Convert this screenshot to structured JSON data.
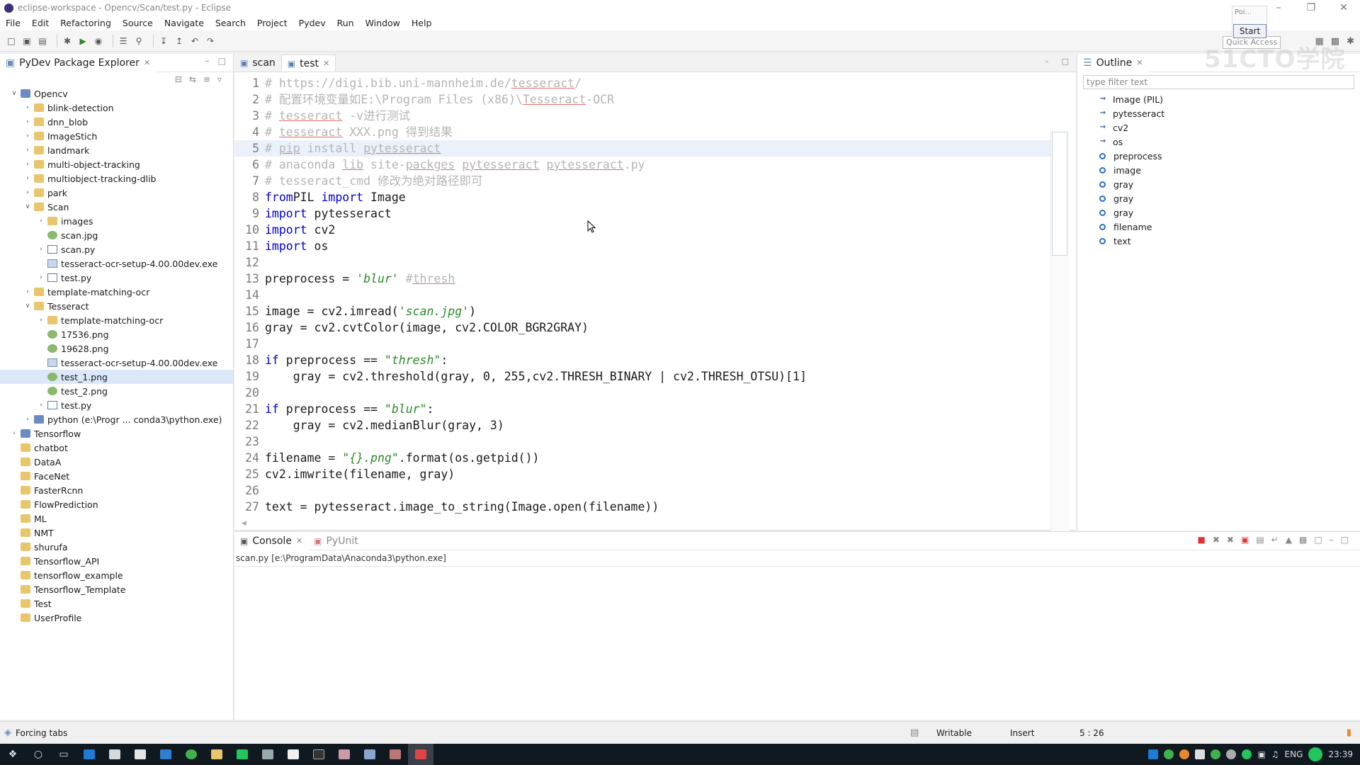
{
  "window": {
    "title": "eclipse-workspace - Opencv/Scan/test.py - Eclipse"
  },
  "menu": [
    "File",
    "Edit",
    "Refactoring",
    "Source",
    "Navigate",
    "Search",
    "Project",
    "Pydev",
    "Run",
    "Window",
    "Help"
  ],
  "toolbar": {
    "quick_access": "Quick Access",
    "popup_text": "Poi...",
    "start_label": "Start"
  },
  "explorer": {
    "title": "PyDev Package Explorer",
    "tree": [
      {
        "label": "Opencv",
        "depth": 0,
        "icon": "project",
        "open": true
      },
      {
        "label": "blink-detection",
        "depth": 1,
        "icon": "folder"
      },
      {
        "label": "dnn_blob",
        "depth": 1,
        "icon": "folder"
      },
      {
        "label": "ImageStich",
        "depth": 1,
        "icon": "folder"
      },
      {
        "label": "landmark",
        "depth": 1,
        "icon": "folder"
      },
      {
        "label": "multi-object-tracking",
        "depth": 1,
        "icon": "folder"
      },
      {
        "label": "multiobject-tracking-dlib",
        "depth": 1,
        "icon": "folder"
      },
      {
        "label": "park",
        "depth": 1,
        "icon": "folder"
      },
      {
        "label": "Scan",
        "depth": 1,
        "icon": "folder",
        "open": true
      },
      {
        "label": "images",
        "depth": 2,
        "icon": "folder"
      },
      {
        "label": "scan.jpg",
        "depth": 2,
        "icon": "image",
        "leaf": true
      },
      {
        "label": "scan.py",
        "depth": 2,
        "icon": "python"
      },
      {
        "label": "tesseract-ocr-setup-4.00.00dev.exe",
        "depth": 2,
        "icon": "exe",
        "leaf": true
      },
      {
        "label": "test.py",
        "depth": 2,
        "icon": "python"
      },
      {
        "label": "template-matching-ocr",
        "depth": 1,
        "icon": "folder"
      },
      {
        "label": "Tesseract",
        "depth": 1,
        "icon": "folder",
        "open": true
      },
      {
        "label": "template-matching-ocr",
        "depth": 2,
        "icon": "folder"
      },
      {
        "label": "17536.png",
        "depth": 2,
        "icon": "image",
        "leaf": true
      },
      {
        "label": "19628.png",
        "depth": 2,
        "icon": "image",
        "leaf": true
      },
      {
        "label": "tesseract-ocr-setup-4.00.00dev.exe",
        "depth": 2,
        "icon": "exe",
        "leaf": true
      },
      {
        "label": "test_1.png",
        "depth": 2,
        "icon": "image",
        "leaf": true,
        "selected": true
      },
      {
        "label": "test_2.png",
        "depth": 2,
        "icon": "image",
        "leaf": true
      },
      {
        "label": "test.py",
        "depth": 2,
        "icon": "python"
      },
      {
        "label": "python  (e:\\Progr ... conda3\\python.exe)",
        "depth": 1,
        "icon": "interpreter"
      },
      {
        "label": "Tensorflow",
        "depth": 0,
        "icon": "project"
      },
      {
        "label": "chatbot",
        "depth": 0,
        "icon": "folder",
        "leaf": true
      },
      {
        "label": "DataA",
        "depth": 0,
        "icon": "folder",
        "leaf": true
      },
      {
        "label": "FaceNet",
        "depth": 0,
        "icon": "folder",
        "leaf": true
      },
      {
        "label": "FasterRcnn",
        "depth": 0,
        "icon": "folder",
        "leaf": true
      },
      {
        "label": "FlowPrediction",
        "depth": 0,
        "icon": "folder",
        "leaf": true
      },
      {
        "label": "ML",
        "depth": 0,
        "icon": "folder",
        "leaf": true
      },
      {
        "label": "NMT",
        "depth": 0,
        "icon": "folder",
        "leaf": true
      },
      {
        "label": "shurufa",
        "depth": 0,
        "icon": "folder",
        "leaf": true
      },
      {
        "label": "Tensorflow_API",
        "depth": 0,
        "icon": "folder",
        "leaf": true
      },
      {
        "label": "tensorflow_example",
        "depth": 0,
        "icon": "folder",
        "leaf": true
      },
      {
        "label": "Tensorflow_Template",
        "depth": 0,
        "icon": "folder",
        "leaf": true
      },
      {
        "label": "Test",
        "depth": 0,
        "icon": "folder",
        "leaf": true
      },
      {
        "label": "UserProfile",
        "depth": 0,
        "icon": "folder",
        "leaf": true
      }
    ]
  },
  "editor": {
    "tabs": [
      {
        "label": "scan",
        "active": false
      },
      {
        "label": "test",
        "active": true
      }
    ],
    "current_line": 5,
    "lines": [
      [
        [
          "cmt",
          "# https://digi.bib.uni-mannheim.de/tesseract/"
        ]
      ],
      [
        [
          "cmt",
          "# 配置环境变量如E:\\Program Files (x86)\\Tesseract-OCR"
        ]
      ],
      [
        [
          "cmt",
          "# tesseract -v进行测试"
        ]
      ],
      [
        [
          "cmt",
          "# tesseract XXX.png 得到结果"
        ]
      ],
      [
        [
          "cmt",
          "# pip install pytesseract"
        ]
      ],
      [
        [
          "cmt",
          "# anaconda lib site-packges pytesseract pytesseract.py"
        ]
      ],
      [
        [
          "cmt",
          "# tesseract_cmd 修改为绝对路径即可"
        ]
      ],
      [
        [
          "kw",
          "from"
        ],
        [
          "",
          "PIL "
        ],
        [
          "kw",
          "import"
        ],
        [
          "",
          " Image"
        ]
      ],
      [
        [
          "kw",
          "import"
        ],
        [
          "",
          " pytesseract"
        ]
      ],
      [
        [
          "kw",
          "import"
        ],
        [
          "",
          " cv2"
        ]
      ],
      [
        [
          "kw",
          "import"
        ],
        [
          "",
          " os"
        ]
      ],
      [],
      [
        [
          "",
          "preprocess = "
        ],
        [
          "str",
          "'blur'"
        ],
        [
          "",
          ""
        ],
        [
          "cmt",
          " #thresh"
        ]
      ],
      [],
      [
        [
          "",
          "image = cv2.imread("
        ],
        [
          "str",
          "'scan.jpg'"
        ],
        [
          "",
          ")"
        ]
      ],
      [
        [
          "",
          "gray = cv2.cvtColor(image, cv2.COLOR_BGR2GRAY)"
        ]
      ],
      [],
      [
        [
          "kw",
          "if"
        ],
        [
          "",
          " preprocess == "
        ],
        [
          "str",
          "\"thresh\""
        ],
        [
          "",
          ":"
        ]
      ],
      [
        [
          "",
          "    gray = cv2.threshold(gray, 0, 255,cv2.THRESH_BINARY | cv2.THRESH_OTSU)[1]"
        ]
      ],
      [],
      [
        [
          "kw",
          "if"
        ],
        [
          "",
          " preprocess == "
        ],
        [
          "str",
          "\"blur\""
        ],
        [
          "",
          ":"
        ]
      ],
      [
        [
          "",
          "    gray = cv2.medianBlur(gray, 3)"
        ]
      ],
      [],
      [
        [
          "",
          "filename = "
        ],
        [
          "str",
          "\"{}.png\""
        ],
        [
          "",
          ".format(os.getpid())"
        ]
      ],
      [
        [
          "",
          "cv2.imwrite(filename, gray)"
        ]
      ],
      [],
      [
        [
          "",
          "text = pytesseract.image_to_string(Image.open(filename))"
        ]
      ]
    ]
  },
  "outline": {
    "title": "Outline",
    "filter_placeholder": "type filter text",
    "items": [
      {
        "label": "Image (PIL)",
        "kind": "import"
      },
      {
        "label": "pytesseract",
        "kind": "import"
      },
      {
        "label": "cv2",
        "kind": "import"
      },
      {
        "label": "os",
        "kind": "import"
      },
      {
        "label": "preprocess",
        "kind": "var"
      },
      {
        "label": "image",
        "kind": "var"
      },
      {
        "label": "gray",
        "kind": "var"
      },
      {
        "label": "gray",
        "kind": "var"
      },
      {
        "label": "gray",
        "kind": "var"
      },
      {
        "label": "filename",
        "kind": "var"
      },
      {
        "label": "text",
        "kind": "var"
      }
    ]
  },
  "console": {
    "tabs": [
      {
        "label": "Console",
        "active": true
      },
      {
        "label": "PyUnit",
        "active": false
      }
    ],
    "info": "scan.py [e:\\ProgramData\\Anaconda3\\python.exe]"
  },
  "status": {
    "left": "Forcing tabs",
    "writable": "Writable",
    "insert": "Insert",
    "position": "5 : 26"
  },
  "taskbar": {
    "lang": "ENG",
    "time": "23:39"
  },
  "watermark": "51CTO学院",
  "colors": {
    "keyword": "#0000d8",
    "string": "#2a8a2a",
    "comment": "#b5b5b5",
    "selection": "#dce8f8",
    "current_line": "#eaf1fb"
  }
}
